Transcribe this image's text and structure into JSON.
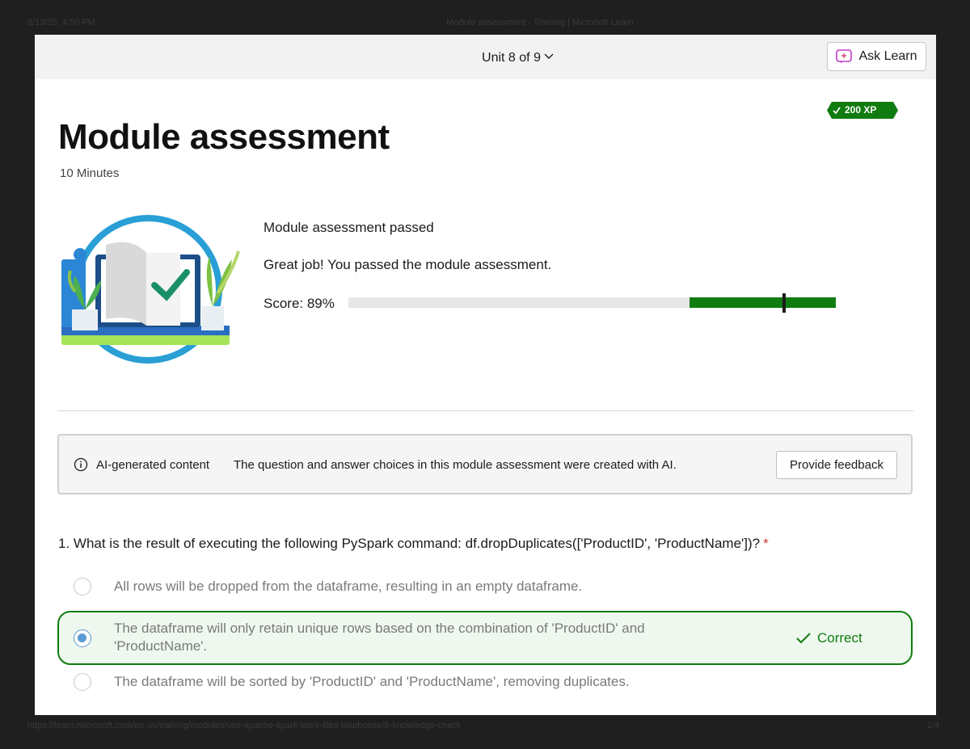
{
  "print": {
    "date": "8/13/25, 4:50 PM",
    "title": "Module assessment - Training | Microsoft Learn",
    "url": "https://learn.microsoft.com/en-us/training/modules/use-apache-spark-work-files-lakehouse/8-knowledge-check",
    "page": "1/4"
  },
  "topbar": {
    "unit_label": "Unit 8 of 9",
    "ask_learn_label": "Ask Learn"
  },
  "xp_badge": "200 XP",
  "header": {
    "title": "Module assessment",
    "duration": "10 Minutes"
  },
  "result": {
    "heading": "Module assessment passed",
    "message": "Great job! You passed the module assessment.",
    "score_label": "Score: 89%",
    "score_value": 89,
    "passing_threshold_fraction": 0.7
  },
  "ai_notice": {
    "label": "AI-generated content",
    "text": "The question and answer choices in this module assessment were created with AI.",
    "feedback_button": "Provide feedback"
  },
  "question": {
    "text": "1. What is the result of executing the following PySpark command: df.dropDuplicates(['ProductID', 'ProductName'])?",
    "required_mark": "*",
    "options": [
      {
        "text": "All rows will be dropped from the dataframe, resulting in an empty dataframe.",
        "selected": false
      },
      {
        "text": "The dataframe will only retain unique rows based on the combination of 'ProductID' and 'ProductName'.",
        "selected": true,
        "feedback": "Correct"
      },
      {
        "text": "The dataframe will be sorted by 'ProductID' and 'ProductName', removing duplicates.",
        "selected": false
      }
    ]
  },
  "colors": {
    "success_green": "#107c10",
    "radio_blue": "#5b9bd5",
    "required_red": "#d13438"
  }
}
